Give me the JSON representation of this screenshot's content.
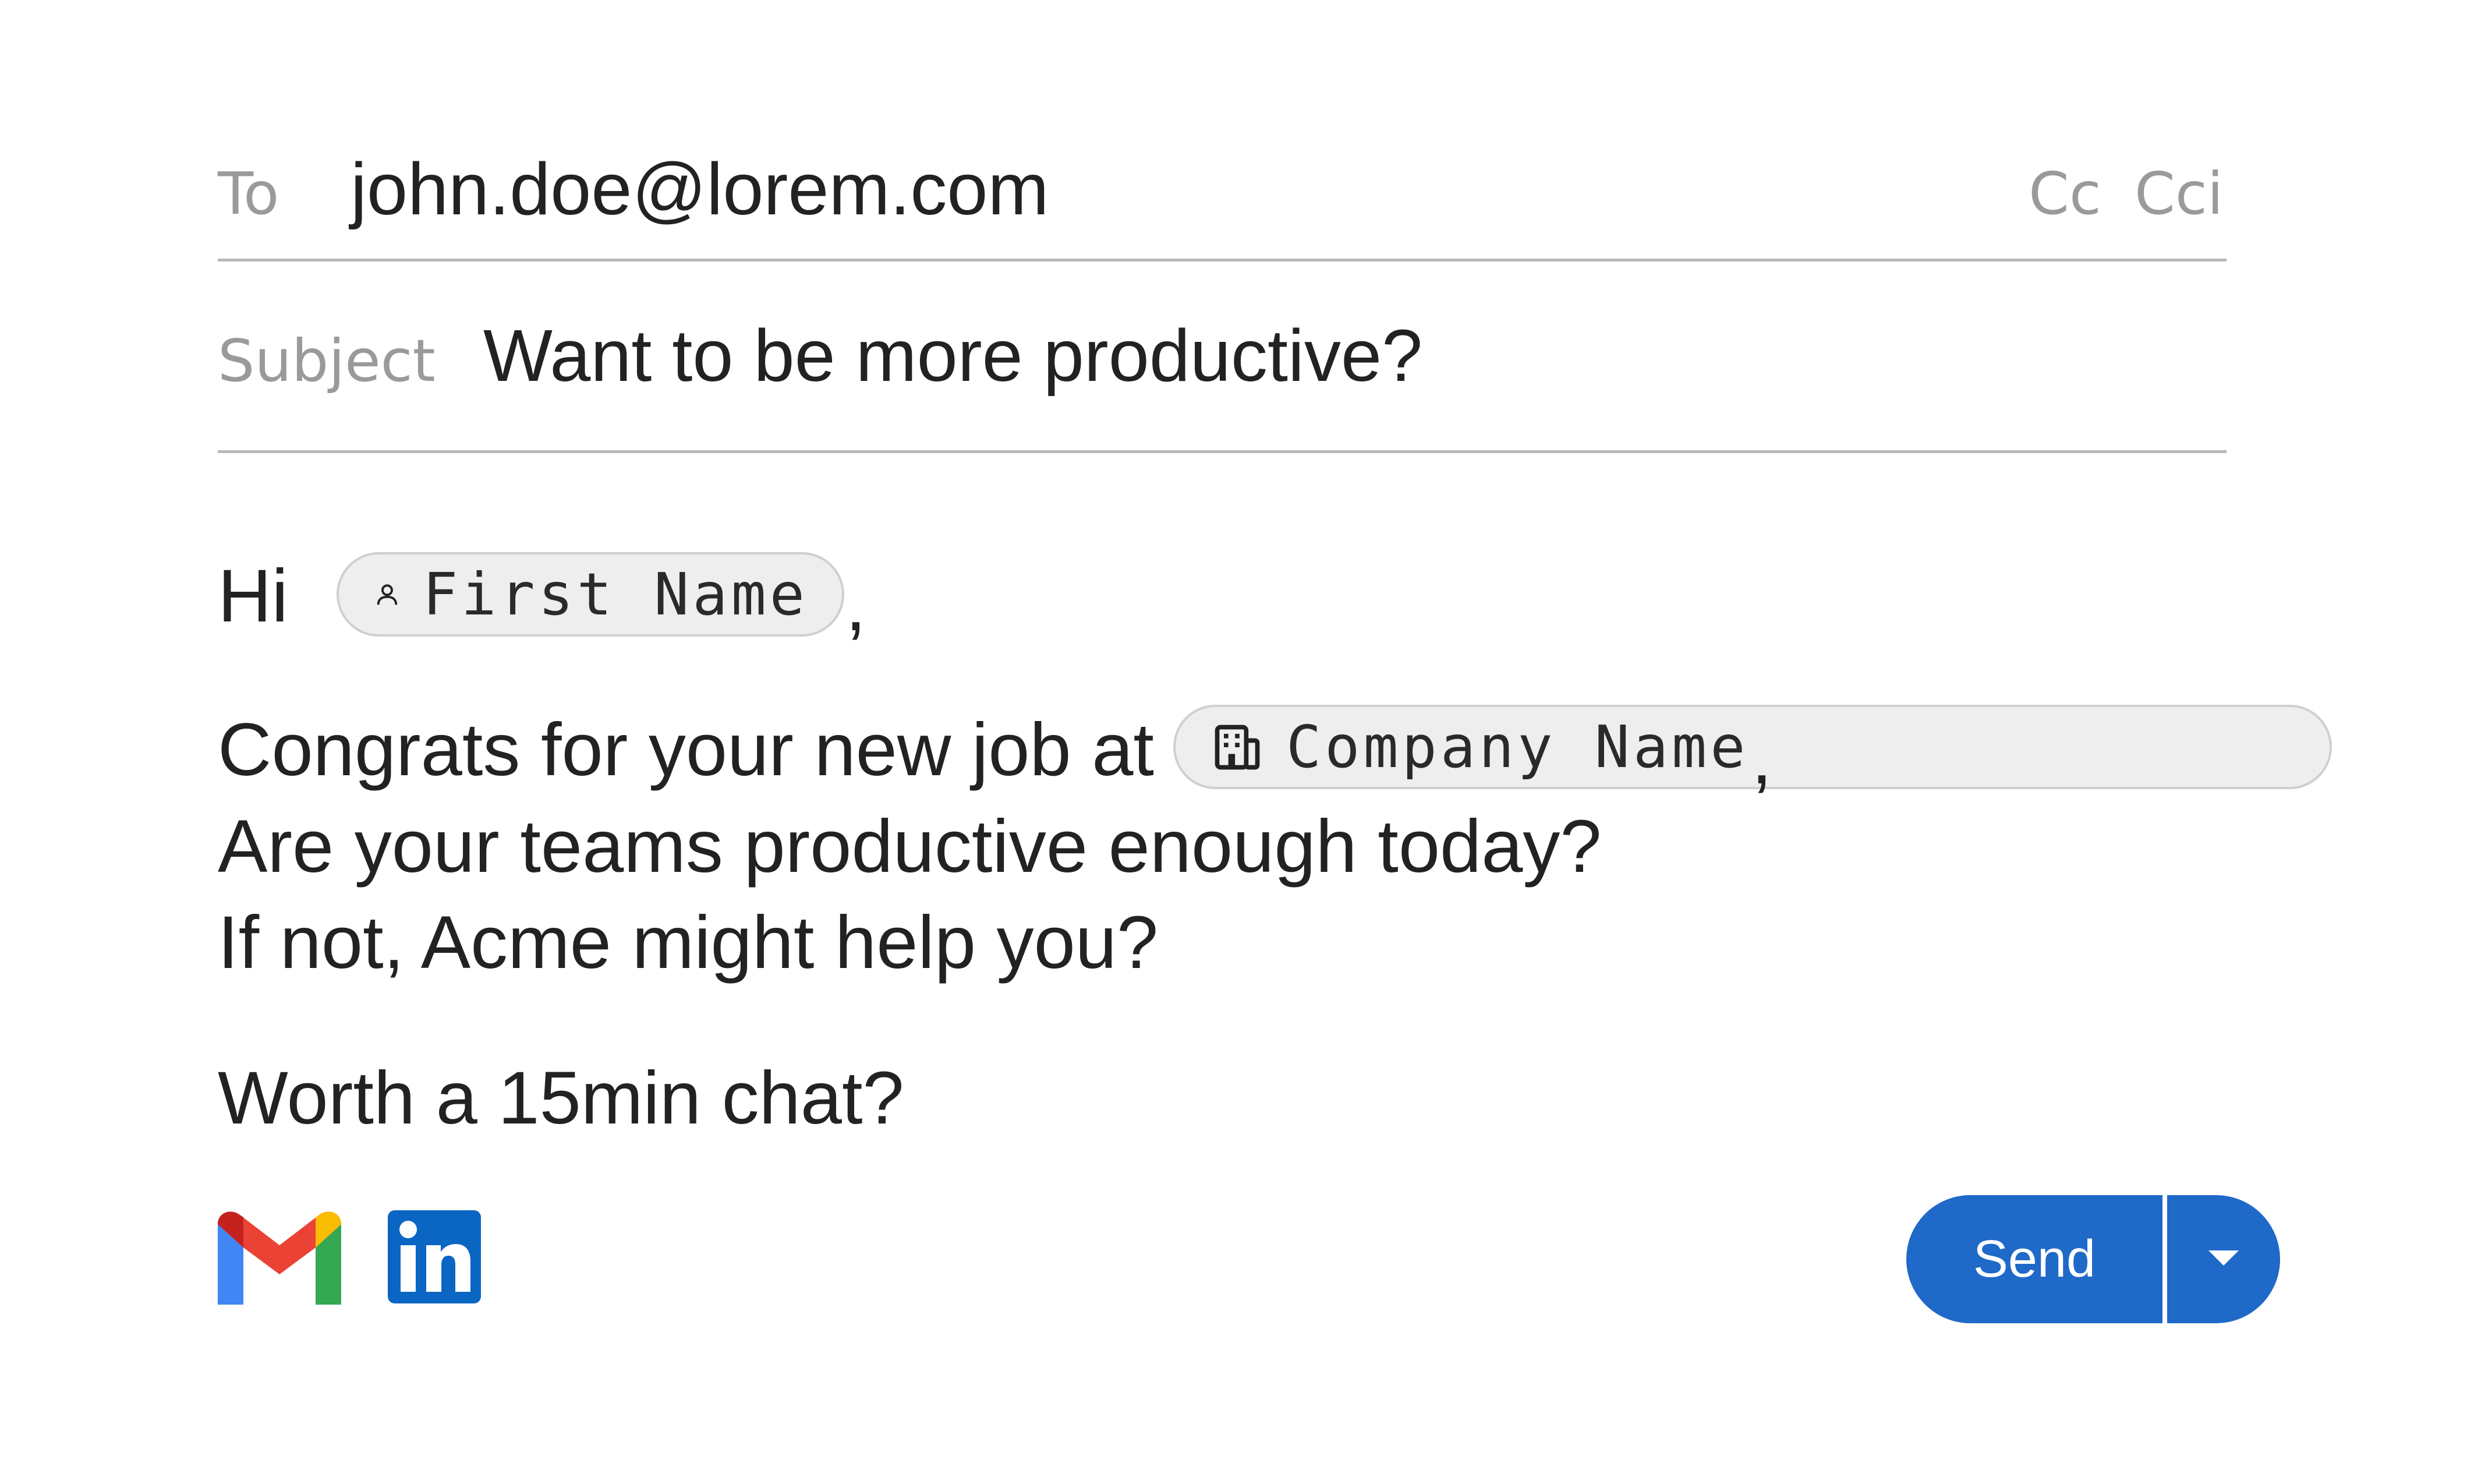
{
  "header": {
    "to_label": "To",
    "to_value": "john.doe@lorem.com",
    "cc_label": "Cc",
    "cci_label": "Cci",
    "subject_label": "Subject",
    "subject_value": "Want to be more productive?"
  },
  "body": {
    "greeting": "Hi",
    "first_name_chip": "First Name",
    "greeting_suffix": ",",
    "line1_prefix": "Congrats for your new job at",
    "company_name_chip": "Company Name",
    "line1_suffix": ",",
    "line2": "Are your teams productive enough today?",
    "line3": "If not, Acme might help you?",
    "line4": "Worth a 15min chat?"
  },
  "footer": {
    "send_label": "Send",
    "icons": [
      "gmail-icon",
      "linkedin-icon"
    ]
  },
  "colors": {
    "accent": "#1f69c8",
    "text": "#222222",
    "muted": "#9a9a9a",
    "chip_bg": "#eeeeee",
    "chip_border": "#cfcfcf",
    "divider": "#b8b8b8",
    "linkedin": "#0a66c2"
  }
}
